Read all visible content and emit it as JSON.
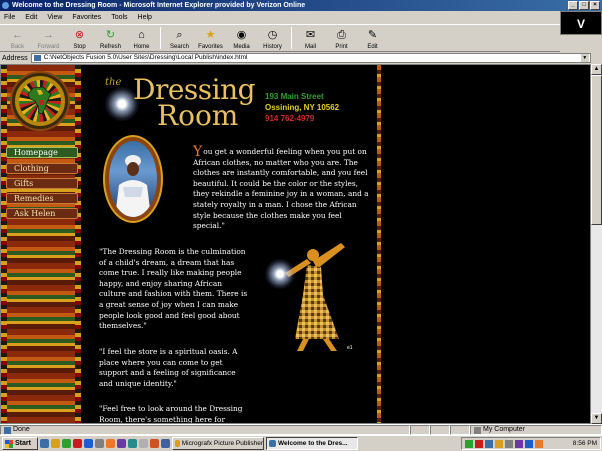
{
  "window": {
    "title": "Welcome to the Dressing Room - Microsoft Internet Explorer provided by Verizon Online",
    "controls": [
      "_",
      "□",
      "×"
    ]
  },
  "menu": [
    "File",
    "Edit",
    "View",
    "Favorites",
    "Tools",
    "Help"
  ],
  "brand_logo": "V",
  "toolbar": [
    {
      "label": "Back",
      "icon": "back-arrow-icon",
      "glyph": "←",
      "enabled": false
    },
    {
      "label": "Forward",
      "icon": "forward-arrow-icon",
      "glyph": "→",
      "enabled": false
    },
    {
      "label": "Stop",
      "icon": "stop-icon",
      "glyph": "⊗",
      "enabled": true
    },
    {
      "label": "Refresh",
      "icon": "refresh-icon",
      "glyph": "↻",
      "enabled": true
    },
    {
      "label": "Home",
      "icon": "home-icon",
      "glyph": "⌂",
      "enabled": true
    },
    {
      "label": "Search",
      "icon": "search-icon",
      "glyph": "⌕",
      "enabled": true
    },
    {
      "label": "Favorites",
      "icon": "favorites-star-icon",
      "glyph": "★",
      "enabled": true
    },
    {
      "label": "Media",
      "icon": "media-icon",
      "glyph": "◉",
      "enabled": true
    },
    {
      "label": "History",
      "icon": "history-icon",
      "glyph": "◷",
      "enabled": true
    },
    {
      "label": "Mail",
      "icon": "mail-icon",
      "glyph": "✉",
      "enabled": true
    },
    {
      "label": "Print",
      "icon": "print-icon",
      "glyph": "⎙",
      "enabled": true
    },
    {
      "label": "Edit",
      "icon": "edit-icon",
      "glyph": "✎",
      "enabled": true
    }
  ],
  "address": {
    "label": "Address",
    "value": "C:\\NetObjects Fusion 5.0\\User Sites\\Dressing\\Local Publish\\index.html"
  },
  "page": {
    "brand_the": "the",
    "brand_dressing": "Dressing",
    "brand_room": "Room",
    "street": "193 Main Street",
    "city": "Ossining, NY 10562",
    "phone": "914  762-4979",
    "nav": [
      "Homepage",
      "Clothing",
      "Gifts",
      "Remedies",
      "Ask Helen"
    ],
    "intro_dropcap": "Y",
    "intro": "ou get a wonderful feeling when you put on African clothes, no matter who you are. The clothes are instantly comfortable, and you feel beautiful. It could be the color or the styles, they rekindle a feminine joy in a woman, and a stately royalty in a man. I chose the African style because the clothes make you feel special.\"",
    "quote1": "\"The Dressing Room is the culmination of a child's dream, a dream that has come true. I really like making people happy, and enjoy sharing African culture and fashion with them. There is a great sense of joy when I can make people look good and feel good about themselves.\"",
    "quote2": "\"I feel the store is a spiritual oasis. A place where you can come to get support and a feeling of significance and unique identity.\"",
    "quote3": "\"Feel free to look around the Dressing Room, there's something here for",
    "figure_mark": "e1"
  },
  "status": {
    "text": "Done",
    "zone": "My Computer"
  },
  "taskbar": {
    "start": "Start",
    "tasks": [
      {
        "label": "Micrografx Picture Publisher",
        "active": false
      },
      {
        "label": "Welcome to the Dres...",
        "active": true
      }
    ],
    "clock": "8:56 PM"
  },
  "colors": {
    "title_bar": "#0a246a",
    "address_green": "#2ea02e",
    "address_yellow": "#e8d020",
    "address_red": "#d22a2a",
    "brand_gold": "#e8c060"
  }
}
